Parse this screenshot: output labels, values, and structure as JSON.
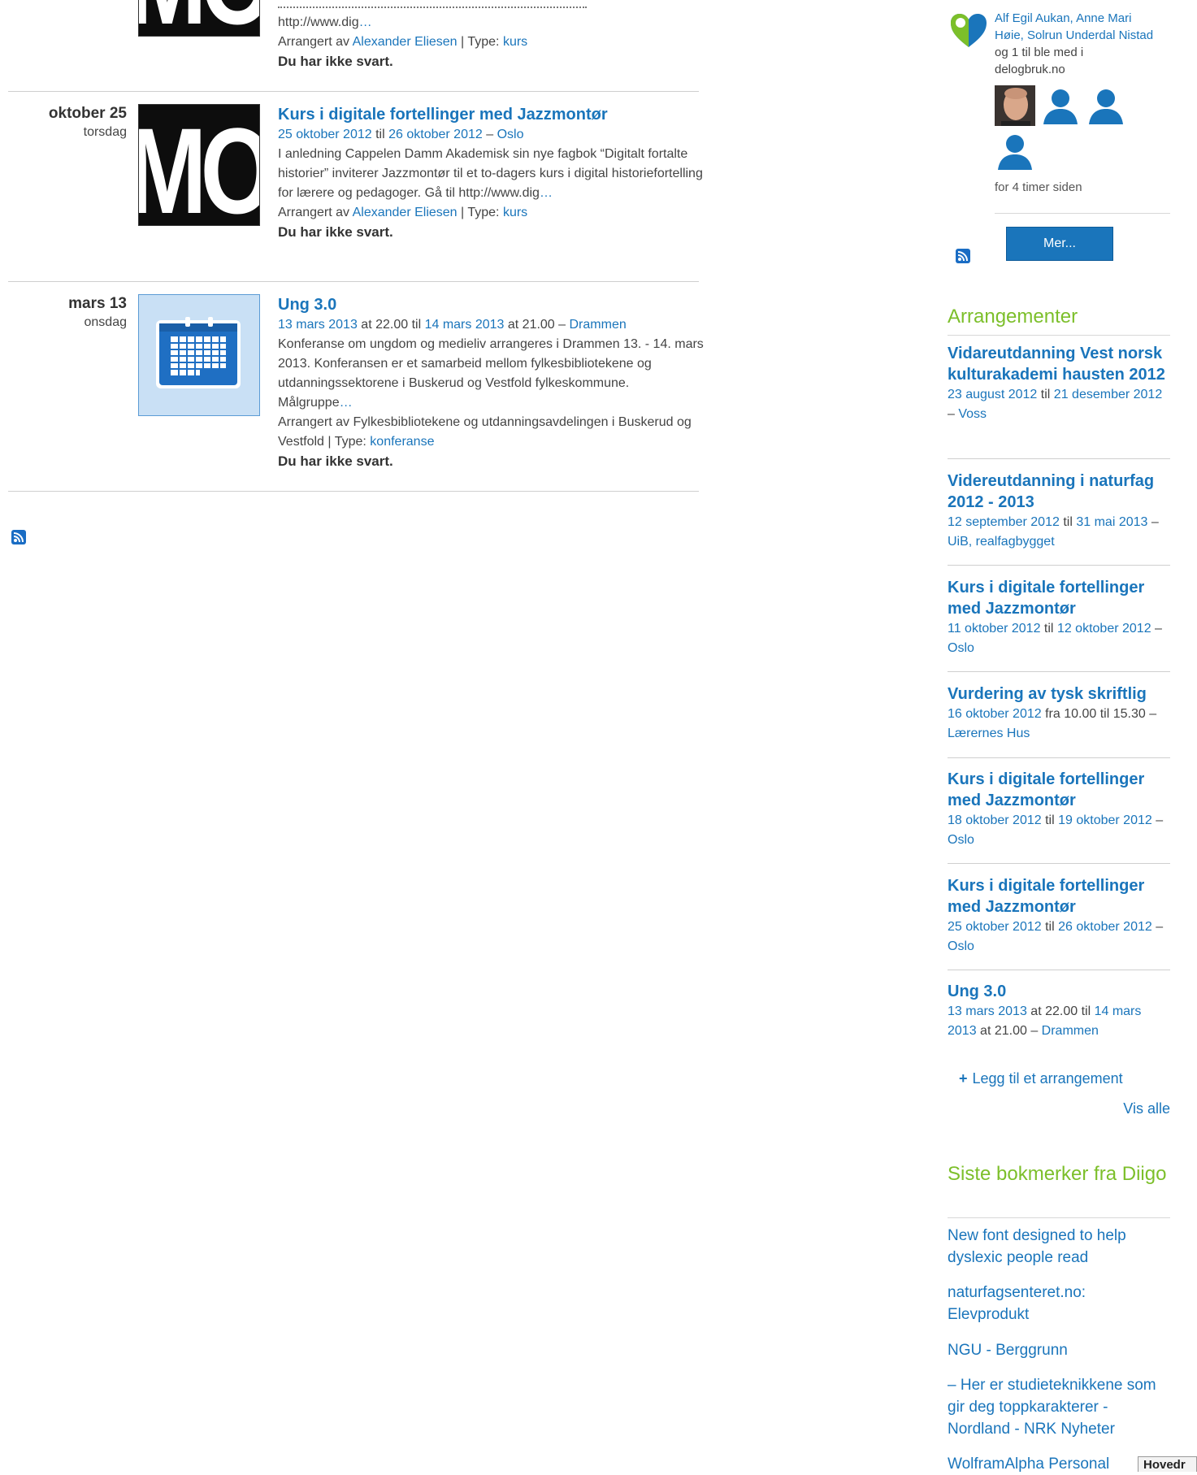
{
  "events": [
    {
      "more_text": "http://www.dig",
      "more_link": "…",
      "organized_prefix": "Arrangert av",
      "organizer": "Alexander Eliesen",
      "type_prefix": "| Type:",
      "type": "kurs",
      "rsvp": "Du har ikke svart.",
      "thumb_text": "MON"
    },
    {
      "date": "oktober 25",
      "weekday": "torsdag",
      "title": "Kurs i digitale fortellinger med Jazzmontør",
      "start": "25 oktober 2012",
      "til": "til",
      "end": "26 oktober 2012",
      "dash": "–",
      "location": "Oslo",
      "description": "I anledning Cappelen Damm Akademisk sin nye fagbok “Digitalt fortalte historier” inviterer Jazzmontør til et to-dagers kurs i digital historiefortelling for lærere og pedagoger. Gå til http://www.dig",
      "more_link": "…",
      "organized_prefix": "Arrangert av",
      "organizer": "Alexander Eliesen",
      "type_prefix": "| Type:",
      "type": "kurs",
      "rsvp": "Du har ikke svart.",
      "thumb_text": "MON"
    },
    {
      "date": "mars 13",
      "weekday": "onsdag",
      "title": "Ung 3.0",
      "start": "13 mars 2013",
      "start_time": "at 22.00 til",
      "end": "14 mars 2013",
      "end_time": "at 21.00 –",
      "location": "Drammen",
      "description": "Konferanse om ungdom og medieliv arrangeres i Drammen 13. - 14. mars 2013. Konferansen er et samarbeid mellom fylkesbibliotekene og utdanningssektorene i Buskerud og Vestfold fylkeskommune. Målgruppe",
      "more_link": "…",
      "organized_prefix": "Arrangert av Fylkesbibliotekene og utdanningsavdelingen i Buskerud og Vestfold",
      "type_prefix": "| Type:",
      "type": "konferanse",
      "rsvp": "Du har ikke svart."
    }
  ],
  "activity": {
    "names": "Alf Egil Aukan, Anne Mari Høie, Solrun Underdal Nistad",
    "suffix_og": "og 1 til",
    "suffix": "ble med i delogbruk.no",
    "time": "for 4 timer siden",
    "more_button": "Mer..."
  },
  "arrangementer": {
    "heading": "Arrangementer",
    "items": [
      {
        "title": "Vidareutdanning Vest norsk kulturakademi hausten 2012",
        "start": "23 august 2012",
        "mid": "til",
        "end": "21 desember 2012",
        "sep": "–",
        "location": "Voss"
      },
      {
        "title": "Videreutdanning i naturfag 2012 - 2013",
        "start": "12 september 2012",
        "mid": "til",
        "end": "31 mai 2013",
        "sep": "–",
        "location": "UiB, realfagbygget"
      },
      {
        "title": "Kurs i digitale fortellinger med Jazzmontør",
        "start": "11 oktober 2012",
        "mid": "til",
        "end": "12 oktober 2012",
        "sep": "–",
        "location": "Oslo"
      },
      {
        "title": "Vurdering av tysk skriftlig",
        "start": "16 oktober 2012",
        "mid": "fra 10.00 til 15.30 –",
        "end": "",
        "sep": "",
        "location": "Lærernes Hus"
      },
      {
        "title": "Kurs i digitale fortellinger med Jazzmontør",
        "start": "18 oktober 2012",
        "mid": "til",
        "end": "19 oktober 2012",
        "sep": "–",
        "location": "Oslo"
      },
      {
        "title": "Kurs i digitale fortellinger med Jazzmontør",
        "start": "25 oktober 2012",
        "mid": "til",
        "end": "26 oktober 2012",
        "sep": "–",
        "location": "Oslo"
      },
      {
        "title": "Ung 3.0",
        "start": "13 mars 2013",
        "mid": "at 22.00 til",
        "end": "14 mars 2013",
        "sep": "at 21.00 –",
        "location": "Drammen"
      }
    ],
    "add_label": "Legg til et arrangement",
    "view_all": "Vis alle"
  },
  "bookmarks": {
    "heading": "Siste bokmerker fra Diigo",
    "items": [
      "New font designed to help dyslexic people read",
      "naturfagsenteret.no: Elevprodukt",
      "NGU - Berggrunn",
      "– Her er studieteknikkene som gir deg toppkarakterer - Nordland - NRK Nyheter",
      "WolframAlpha Personal"
    ]
  },
  "bottom_tab": "Hovedr",
  "colors": {
    "link": "#1a75bb",
    "heading_green": "#7cbf2a",
    "rss": "#1a6dc4"
  },
  "icons": [
    "rss-icon",
    "calendar-icon",
    "group-heart-icon",
    "user-silhouette-icon",
    "plus-icon"
  ]
}
